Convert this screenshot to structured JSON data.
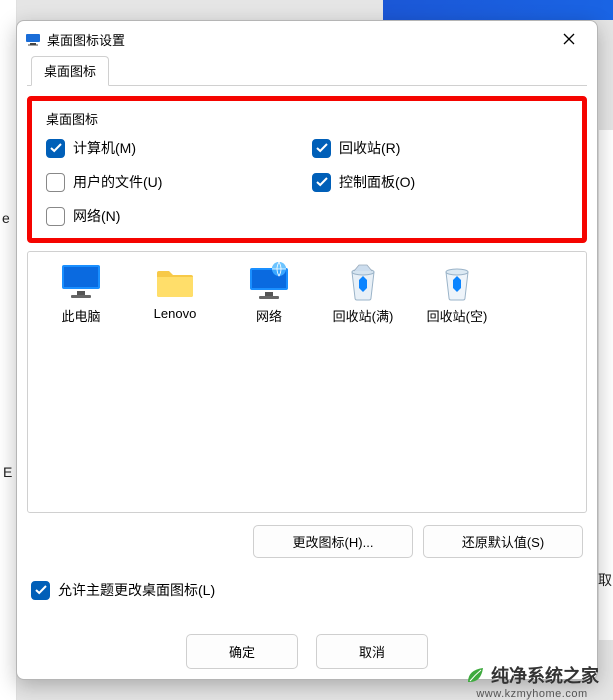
{
  "window": {
    "title": "桌面图标设置",
    "close_label": "关闭"
  },
  "tab": {
    "label": "桌面图标"
  },
  "group": {
    "label": "桌面图标",
    "items": [
      {
        "label": "计算机(M)",
        "checked": true
      },
      {
        "label": "回收站(R)",
        "checked": true
      },
      {
        "label": "用户的文件(U)",
        "checked": false
      },
      {
        "label": "控制面板(O)",
        "checked": true
      },
      {
        "label": "网络(N)",
        "checked": false
      }
    ]
  },
  "icons": [
    {
      "name": "此电脑"
    },
    {
      "name": "Lenovo"
    },
    {
      "name": "网络"
    },
    {
      "name": "回收站(满)"
    },
    {
      "name": "回收站(空)"
    }
  ],
  "buttons": {
    "change_icon": "更改图标(H)...",
    "restore_default": "还原默认值(S)"
  },
  "allow_themes": {
    "label": "允许主题更改桌面图标(L)",
    "checked": true
  },
  "footer": {
    "ok": "确定",
    "cancel": "取消"
  },
  "watermark": {
    "text": "纯净系统之家",
    "url": "www.kzmyhome.com"
  },
  "stray": {
    "e": "E",
    "q": "取"
  }
}
